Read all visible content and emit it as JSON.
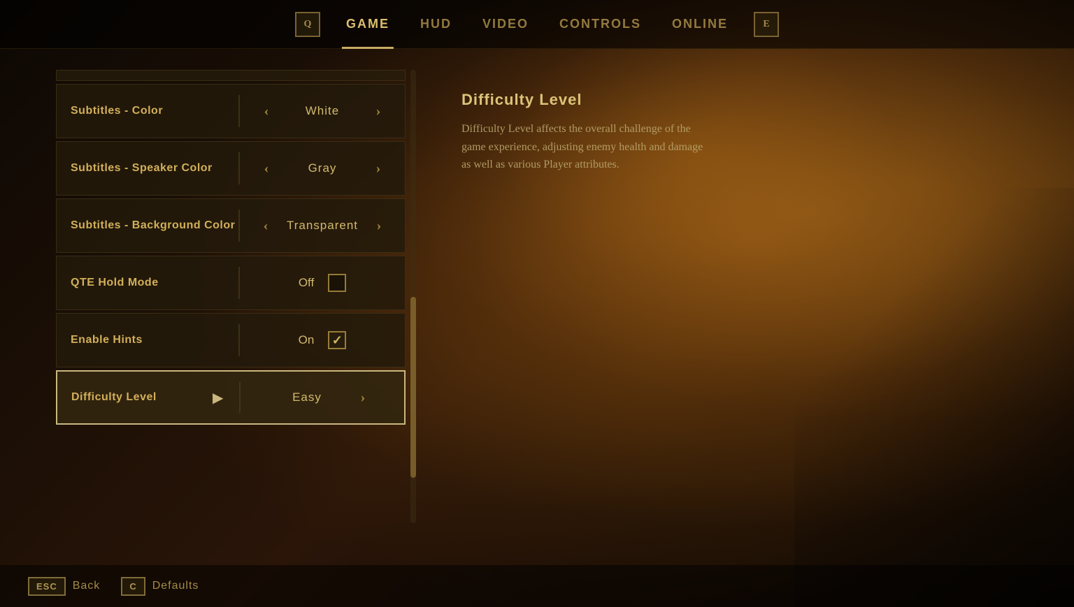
{
  "background": {
    "color": "#1a1008"
  },
  "nav": {
    "tabs": [
      {
        "id": "game",
        "label": "GAME",
        "active": true
      },
      {
        "id": "hud",
        "label": "HUD",
        "active": false
      },
      {
        "id": "video",
        "label": "VIDEO",
        "active": false
      },
      {
        "id": "controls",
        "label": "CONTROLS",
        "active": false
      },
      {
        "id": "online",
        "label": "ONLINE",
        "active": false
      }
    ],
    "left_icon": "Q",
    "right_icon": "E"
  },
  "settings": {
    "rows": [
      {
        "id": "subtitles-color",
        "label": "Subtitles - Color",
        "type": "select",
        "value": "White",
        "active": false
      },
      {
        "id": "subtitles-speaker-color",
        "label": "Subtitles - Speaker Color",
        "type": "select",
        "value": "Gray",
        "active": false
      },
      {
        "id": "subtitles-background-color",
        "label": "Subtitles - Background Color",
        "type": "select",
        "value": "Transparent",
        "active": false
      },
      {
        "id": "qte-hold-mode",
        "label": "QTE Hold Mode",
        "type": "checkbox",
        "value": "Off",
        "checked": false,
        "active": false
      },
      {
        "id": "enable-hints",
        "label": "Enable Hints",
        "type": "checkbox",
        "value": "On",
        "checked": true,
        "active": false
      },
      {
        "id": "difficulty-level",
        "label": "Difficulty Level",
        "type": "select",
        "value": "Easy",
        "active": true
      }
    ]
  },
  "info_panel": {
    "title": "Difficulty Level",
    "description": "Difficulty Level affects the overall challenge of the game experience, adjusting enemy health and damage as well as various Player attributes."
  },
  "bottom_bar": {
    "back_key": "ESC",
    "back_label": "Back",
    "defaults_key": "C",
    "defaults_label": "Defaults"
  }
}
